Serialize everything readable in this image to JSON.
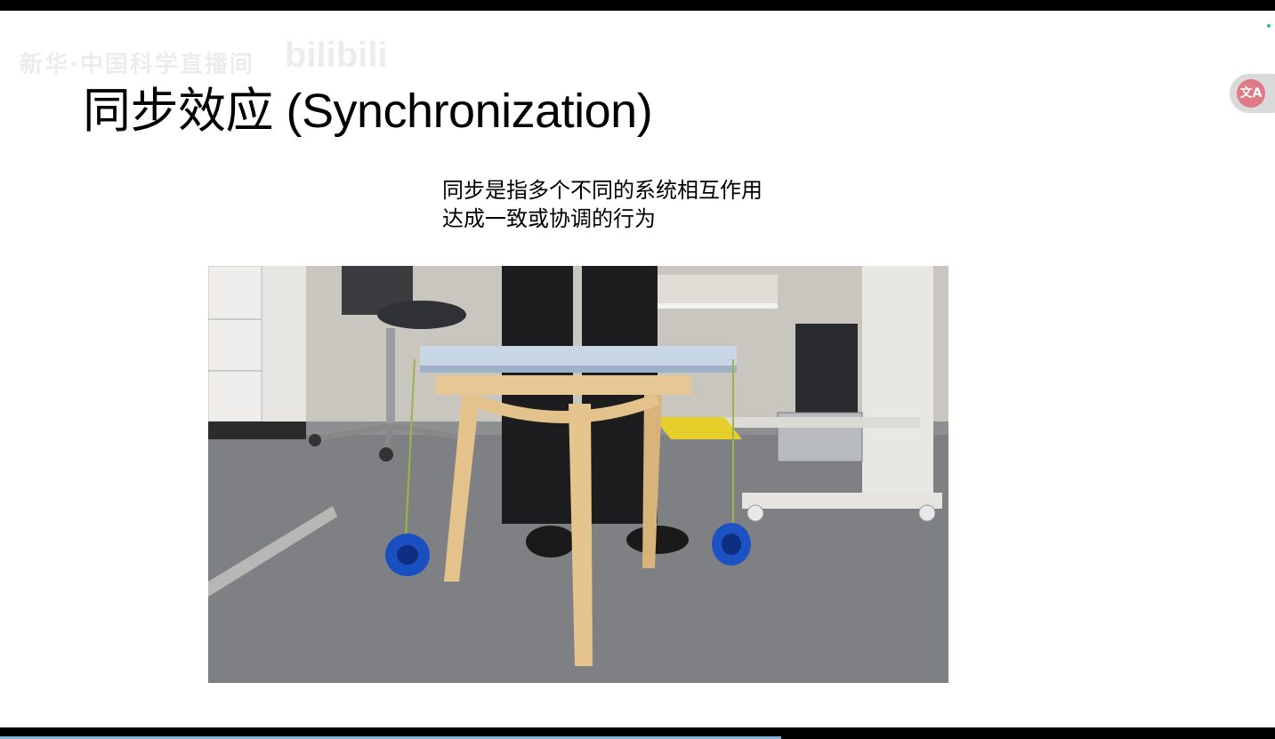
{
  "watermark": {
    "text": "新华·中国科学直播间",
    "logo": "bilibili"
  },
  "slide": {
    "title": "同步效应 (Synchronization)",
    "description_line1": "同步是指多个不同的系统相互作用",
    "description_line2": "达成一致或协调的行为"
  },
  "translate_button": {
    "icon_name": "translate-icon",
    "glyph": "文A"
  },
  "player": {
    "progress_fraction": 0.613
  },
  "colors": {
    "progress": "#7fb3d5",
    "translate_badge": "#e07a86",
    "status_dot": "#2ecc71"
  }
}
